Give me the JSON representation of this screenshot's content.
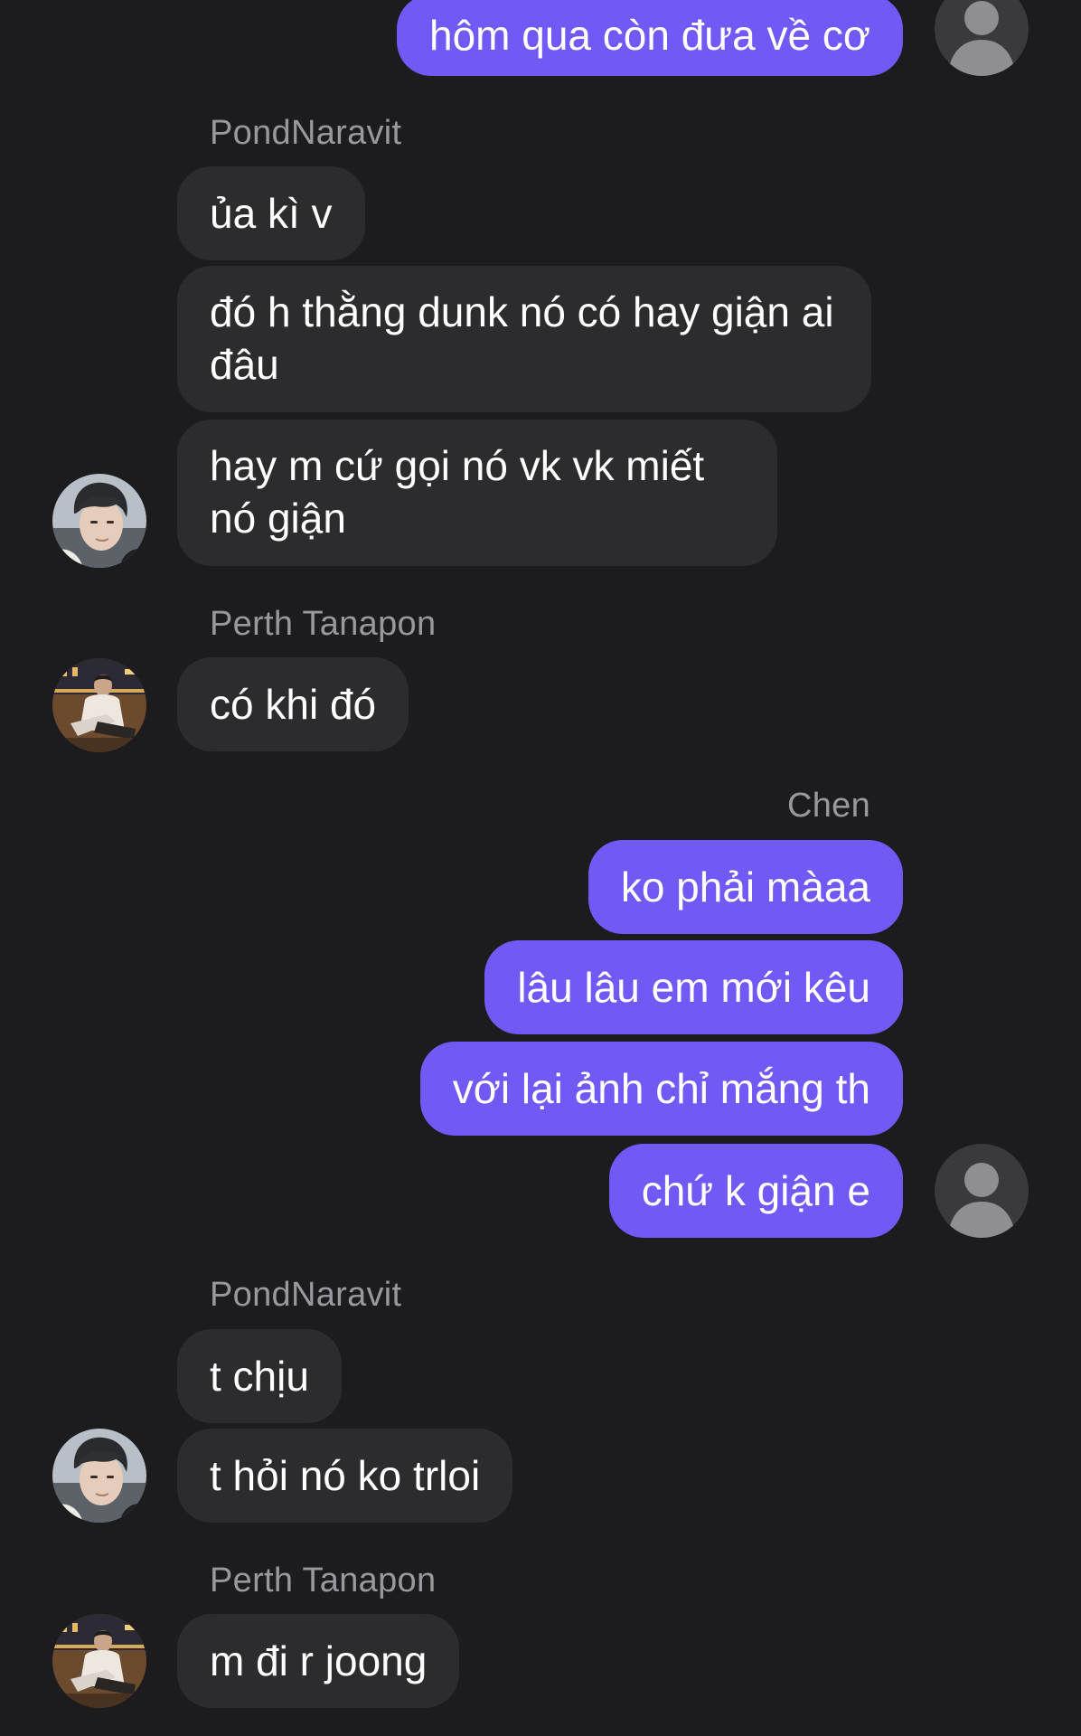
{
  "colors": {
    "background": "#1c1c1e",
    "incoming_bubble": "#2c2c2e",
    "outgoing_bubble": "#7159f5",
    "sender_name": "#98989f",
    "text": "#ffffff"
  },
  "messages": [
    {
      "text": "hôm qua còn đưa về cơ"
    },
    {
      "sender": "PondNaravit"
    },
    {
      "text": "ủa kì v"
    },
    {
      "text": "đó h thằng dunk nó có hay giận ai đâu"
    },
    {
      "text": "hay m cứ gọi nó vk vk miết nó giận"
    },
    {
      "sender": "Perth Tanapon"
    },
    {
      "text": "có khi đó"
    },
    {
      "sender": "Chen"
    },
    {
      "text": "ko phải màaa"
    },
    {
      "text": "lâu lâu em mới kêu"
    },
    {
      "text": "với lại ảnh chỉ mắng th"
    },
    {
      "text": "chứ k giận e"
    },
    {
      "sender": "PondNaravit"
    },
    {
      "text": "t chịu"
    },
    {
      "text": "t hỏi nó ko trloi"
    },
    {
      "sender": "Perth Tanapon"
    },
    {
      "text": "m đi r joong"
    }
  ],
  "avatars": {
    "self": "default-user-icon",
    "pond": "pond-photo",
    "perth": "perth-photo"
  }
}
